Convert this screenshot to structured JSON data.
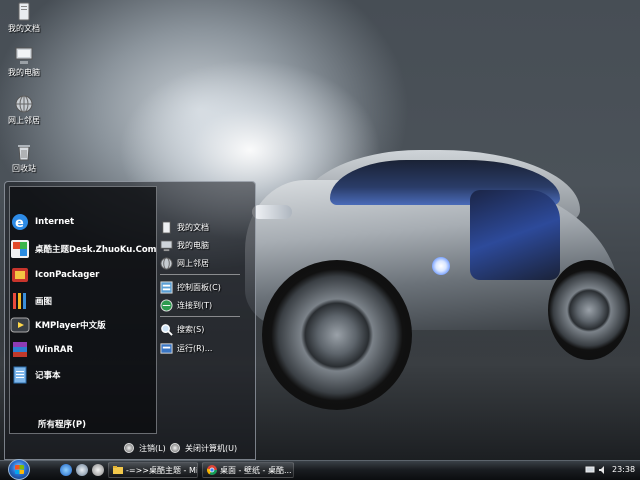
{
  "desktop": {
    "icons": [
      {
        "label": "我的文档",
        "icon": "my-documents-icon"
      },
      {
        "label": "我的电脑",
        "icon": "my-computer-icon"
      },
      {
        "label": "网上邻居",
        "icon": "network-places-icon"
      },
      {
        "label": "回收站",
        "icon": "recycle-bin-icon"
      }
    ]
  },
  "start_menu": {
    "programs": [
      {
        "label": "Internet",
        "icon": "internet-explorer-icon"
      },
      {
        "label": "桌酷主题Desk.ZhuoKu.Com",
        "icon": "zhuoku-theme-icon"
      },
      {
        "label": "IconPackager",
        "icon": "iconpackager-icon"
      },
      {
        "label": "画图",
        "icon": "paint-icon"
      },
      {
        "label": "KMPlayer中文版",
        "icon": "kmplayer-icon"
      },
      {
        "label": "WinRAR",
        "icon": "winrar-icon"
      },
      {
        "label": "记事本",
        "icon": "notepad-icon"
      }
    ],
    "all_programs_label": "所有程序(P)",
    "places": [
      {
        "label": "我的文档",
        "icon": "documents-icon"
      },
      {
        "label": "我的电脑",
        "icon": "computer-icon"
      },
      {
        "label": "网上邻居",
        "icon": "network-icon"
      },
      {
        "label": "控制面板(C)",
        "icon": "control-panel-icon"
      },
      {
        "label": "连接到(T)",
        "icon": "connect-to-icon"
      },
      {
        "label": "搜索(S)",
        "icon": "search-icon"
      },
      {
        "label": "运行(R)...",
        "icon": "run-icon"
      }
    ],
    "logoff_label": "注销(L)",
    "shutdown_label": "关闭计算机(U)"
  },
  "taskbar": {
    "tasks": [
      {
        "label": "-=>>桌酷主题 - Mi...",
        "icon": "folder-icon"
      },
      {
        "label": "桌面 - 壁纸 - 桌酷...",
        "icon": "chrome-icon"
      }
    ],
    "clock": "23:38"
  }
}
